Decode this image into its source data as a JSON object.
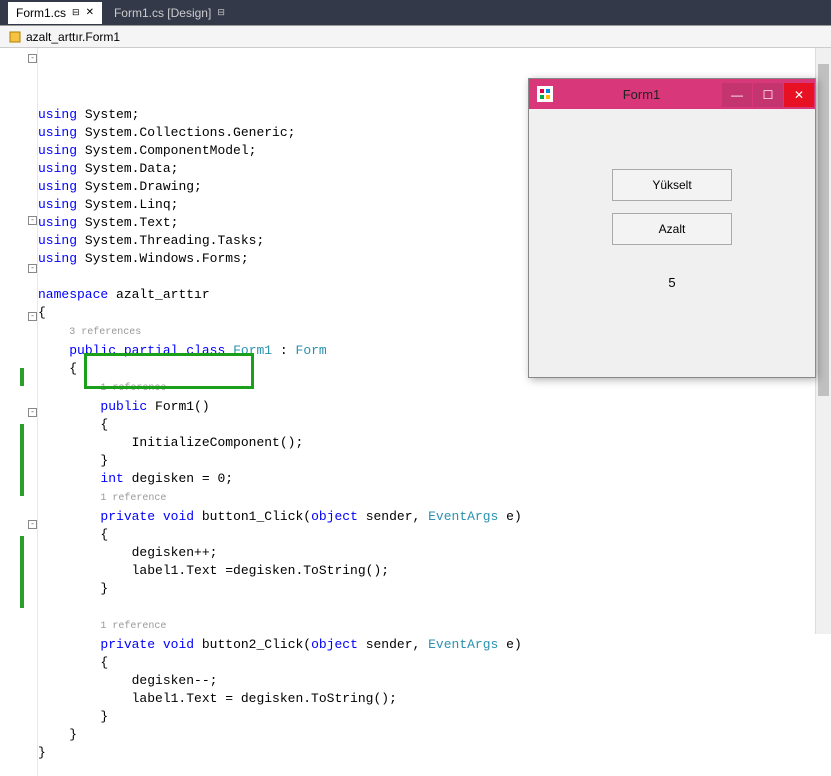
{
  "tabs": {
    "tab1": "Form1.cs",
    "tab2": "Form1.cs [Design]"
  },
  "breadcrumb": {
    "namespace": "azalt_arttır.Form1"
  },
  "code": {
    "using": "using",
    "namespace_kw": "namespace",
    "public_kw": "public",
    "partial_kw": "partial",
    "class_kw": "class",
    "void_kw": "void",
    "private_kw": "private",
    "int_kw": "int",
    "object_kw": "object",
    "sys": "System",
    "sysColl": "System.Collections.Generic",
    "sysComp": "System.ComponentModel",
    "sysData": "System.Data",
    "sysDraw": "System.Drawing",
    "sysLinq": "System.Linq",
    "sysText": "System.Text",
    "sysThread": "System.Threading.Tasks",
    "sysForms": "System.Windows.Forms",
    "ns_name": "azalt_arttır",
    "ref3": "3 references",
    "ref1a": "1 reference",
    "ref1b": "1 reference",
    "ref1c": "1 reference",
    "class_name": "Form1",
    "base_class": "Form",
    "ctor": "Form1()",
    "initComp": "InitializeComponent();",
    "degisken_decl": "degisken = 0;",
    "btn1": "button1_Click(",
    "btn2": "button2_Click(",
    "sender": " sender, ",
    "eventargs": "EventArgs",
    "eParam": " e)",
    "degInc": "degisken++;",
    "degDec": "degisken--;",
    "label1": "label1.Text =degisken.ToString();",
    "label2": "label1.Text = degisken.ToString();"
  },
  "form": {
    "title": "Form1",
    "btnYukselt": "Yükselt",
    "btnAzalt": "Azalt",
    "labelValue": "5",
    "minimize": "—",
    "maximize": "☐",
    "close": "✕"
  }
}
